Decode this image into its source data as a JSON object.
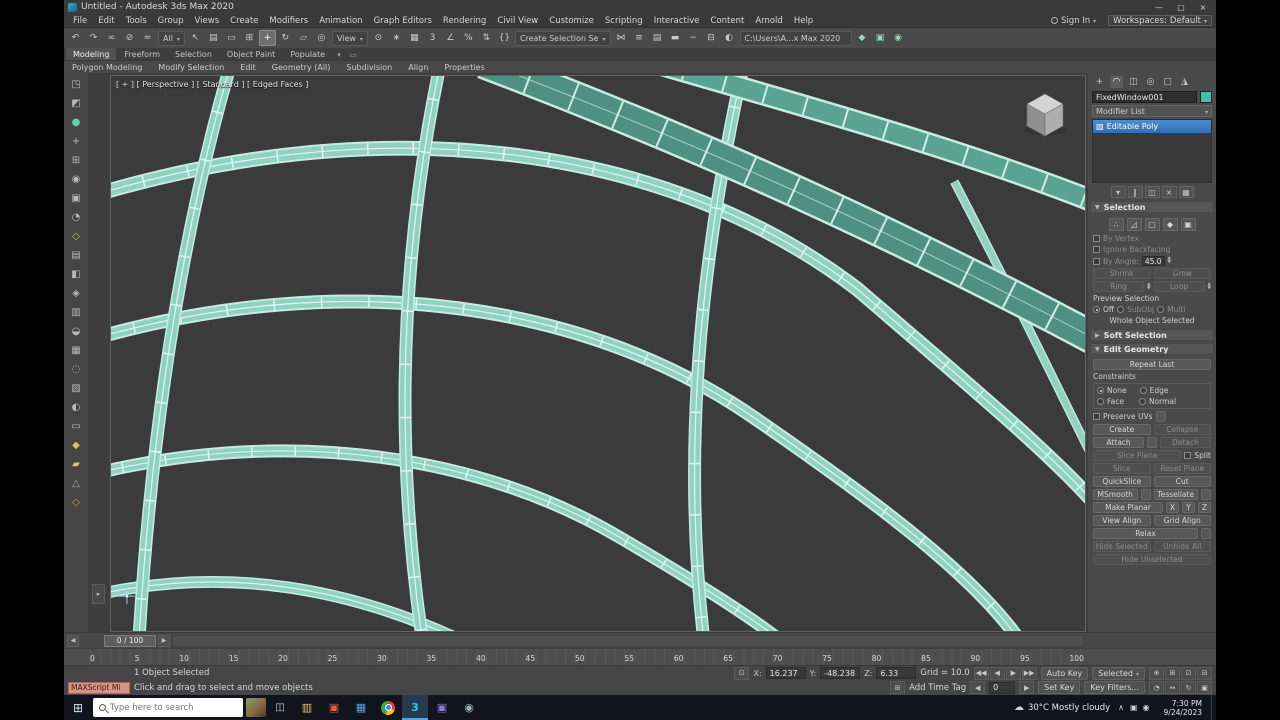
{
  "colors": {
    "frame_teal": "#8fd2c0",
    "frame_teal_dark": "#4e9182",
    "selection_highlight": "#2f6db4",
    "viewport_bg": "#3b3b3b",
    "object_color": "#3fc2a7"
  },
  "titlebar": {
    "title": "Untitled - Autodesk 3ds Max 2020",
    "minimize": "—",
    "maximize": "▢",
    "close": "×"
  },
  "menubar": {
    "items": [
      "File",
      "Edit",
      "Tools",
      "Group",
      "Views",
      "Create",
      "Modifiers",
      "Animation",
      "Graph Editors",
      "Rendering",
      "Civil View",
      "Customize",
      "Scripting",
      "Interactive",
      "Content",
      "Arnold",
      "Help"
    ],
    "sign_in": "Sign In",
    "workspaces_label": "Workspaces:",
    "workspaces_value": "Default"
  },
  "toolbar": {
    "icons_a": [
      {
        "name": "undo-icon",
        "g": "↶"
      },
      {
        "name": "redo-icon",
        "g": "↷"
      },
      {
        "name": "select-and-link-icon",
        "g": "∞"
      },
      {
        "name": "unlink-selection-icon",
        "g": "⊘"
      },
      {
        "name": "bind-to-space-warp-icon",
        "g": "≈"
      }
    ],
    "selection_filter": "All",
    "icons_b": [
      {
        "name": "select-object-icon",
        "g": "↖"
      },
      {
        "name": "select-by-name-icon",
        "g": "▤"
      },
      {
        "name": "rectangular-selection-region-icon",
        "g": "▭"
      },
      {
        "name": "window-crossing-icon",
        "g": "⊞"
      },
      {
        "name": "select-and-move-icon",
        "g": "+",
        "active": true
      },
      {
        "name": "select-and-rotate-icon",
        "g": "↻"
      },
      {
        "name": "select-and-scale-icon",
        "g": "▱"
      },
      {
        "name": "select-and-place-icon",
        "g": "◎"
      }
    ],
    "reference_coordinate": "View",
    "icons_c": [
      {
        "name": "use-pivot-point-center-icon",
        "g": "⊙"
      },
      {
        "name": "select-and-manipulate-icon",
        "g": "∗"
      },
      {
        "name": "keyboard-shortcut-override-icon",
        "g": "▦"
      },
      {
        "name": "snaps-toggle-icon",
        "g": "3"
      },
      {
        "name": "angle-snap-icon",
        "g": "∠"
      },
      {
        "name": "percent-snap-icon",
        "g": "%"
      },
      {
        "name": "spinner-snap-icon",
        "g": "⇅"
      },
      {
        "name": "named-selection-sets-icon",
        "g": "{}"
      }
    ],
    "selection_set": "Create Selection Se",
    "icons_d": [
      {
        "name": "mirror-icon",
        "g": "⋈"
      },
      {
        "name": "align-icon",
        "g": "≡"
      },
      {
        "name": "layer-explorer-icon",
        "g": "▤"
      },
      {
        "name": "ribbon-toggle-icon",
        "g": "▬"
      },
      {
        "name": "curve-editor-icon",
        "g": "~"
      },
      {
        "name": "schematic-view-icon",
        "g": "⊟"
      },
      {
        "name": "material-editor-icon",
        "g": "◐"
      }
    ],
    "project_path": "C:\\Users\\A...x Max 2020",
    "icons_e": [
      {
        "name": "render-setup-icon",
        "g": "◆",
        "fg": "#9fd6b0"
      },
      {
        "name": "rendered-frame-window-icon",
        "g": "▣",
        "fg": "#9fd6b0"
      },
      {
        "name": "render-production-icon",
        "g": "◉",
        "fg": "#9fd6b0"
      }
    ]
  },
  "ribbon": {
    "tabs": [
      {
        "name": "ribbon-tab-modeling",
        "label": "Modeling",
        "active": true
      },
      {
        "name": "ribbon-tab-freeform",
        "label": "Freeform"
      },
      {
        "name": "ribbon-tab-selection",
        "label": "Selection"
      },
      {
        "name": "ribbon-tab-object-paint",
        "label": "Object Paint"
      },
      {
        "name": "ribbon-tab-populate",
        "label": "Populate"
      }
    ],
    "panels": [
      {
        "name": "ribbon-panel-polygon-modeling",
        "label": "Polygon Modeling"
      },
      {
        "name": "ribbon-panel-modify-selection",
        "label": "Modify Selection"
      },
      {
        "name": "ribbon-panel-edit",
        "label": "Edit"
      },
      {
        "name": "ribbon-panel-geometry-all",
        "label": "Geometry (All)"
      },
      {
        "name": "ribbon-panel-subdivision",
        "label": "Subdivision"
      },
      {
        "name": "ribbon-panel-align",
        "label": "Align"
      },
      {
        "name": "ribbon-panel-properties",
        "label": "Properties"
      }
    ]
  },
  "left_toolbar": {
    "icons": [
      {
        "name": "left-tool-icon-1",
        "g": "◳"
      },
      {
        "name": "left-tool-icon-2",
        "g": "◩"
      },
      {
        "name": "left-tool-icon-3",
        "g": "●",
        "fg": "#5fd3b5"
      },
      {
        "name": "left-tool-icon-4",
        "g": "+"
      },
      {
        "name": "left-tool-icon-5",
        "g": "⊞"
      },
      {
        "name": "left-tool-icon-6",
        "g": "◉"
      },
      {
        "name": "left-tool-icon-7",
        "g": "▣"
      },
      {
        "name": "left-tool-icon-8",
        "g": "◔"
      },
      {
        "name": "left-tool-icon-9",
        "g": "◇",
        "fg": "#9fd470"
      },
      {
        "name": "left-tool-icon-10",
        "g": "▤"
      },
      {
        "name": "left-tool-icon-11",
        "g": "◧"
      },
      {
        "name": "left-tool-icon-12",
        "g": "◈"
      },
      {
        "name": "left-tool-icon-13",
        "g": "▥"
      },
      {
        "name": "left-tool-icon-14",
        "g": "◒"
      },
      {
        "name": "left-tool-icon-15",
        "g": "▦"
      },
      {
        "name": "left-tool-icon-16",
        "g": "◌"
      },
      {
        "name": "left-tool-icon-17",
        "g": "▧"
      },
      {
        "name": "left-tool-icon-18",
        "g": "◐"
      },
      {
        "name": "left-tool-icon-19",
        "g": "▭"
      },
      {
        "name": "left-tool-icon-20",
        "g": "◆",
        "fg": "#d9c26a"
      },
      {
        "name": "left-tool-icon-21",
        "g": "▰",
        "fg": "#d9c26a"
      },
      {
        "name": "left-tool-icon-22",
        "g": "△"
      },
      {
        "name": "left-tool-icon-23",
        "g": "◇",
        "fg": "#c9a05a"
      }
    ]
  },
  "viewport": {
    "label": "[ + ] [ Perspective ] [ Standard ] [ Edged Faces ]"
  },
  "command_panel": {
    "tabs": [
      {
        "name": "create-tab-icon",
        "g": "+"
      },
      {
        "name": "modify-tab-icon",
        "g": "◠",
        "active": true
      },
      {
        "name": "hierarchy-tab-icon",
        "g": "◫"
      },
      {
        "name": "motion-tab-icon",
        "g": "◎"
      },
      {
        "name": "display-tab-icon",
        "g": "▢"
      },
      {
        "name": "utilities-tab-icon",
        "g": "◮"
      }
    ],
    "object_name": "FixedWindow001",
    "modifier_list_label": "Modifier List",
    "stack_item": "Editable Poly",
    "stack_buttons": [
      {
        "name": "pin-stack-icon",
        "g": "▾"
      },
      {
        "name": "show-end-result-icon",
        "g": "∥"
      },
      {
        "name": "make-unique-icon",
        "g": "◫"
      },
      {
        "name": "remove-modifier-icon",
        "g": "×"
      },
      {
        "name": "configure-modifier-sets-icon",
        "g": "▦"
      }
    ],
    "selection": {
      "header": "Selection",
      "subobject_icons": [
        {
          "name": "vertex-subobject-icon",
          "g": "∴"
        },
        {
          "name": "edge-subobject-icon",
          "g": "◿"
        },
        {
          "name": "border-subobject-icon",
          "g": "▢"
        },
        {
          "name": "polygon-subobject-icon",
          "g": "◆"
        },
        {
          "name": "element-subobject-icon",
          "g": "▣"
        }
      ],
      "by_vertex": "By Vertex",
      "ignore_backfacing": "Ignore Backfacing",
      "by_angle": "By Angle:",
      "angle_value": "45.0",
      "shrink": "Shrink",
      "grow": "Grow",
      "ring": "Ring",
      "loop": "Loop",
      "preview_label": "Preview Selection",
      "preview_off": "Off",
      "preview_subobj": "SubObj",
      "preview_multi": "Multi",
      "status_text": "Whole Object Selected"
    },
    "soft_selection_header": "Soft Selection",
    "edit_geometry": {
      "header": "Edit Geometry",
      "repeat_last": "Repeat Last",
      "constraints": "Constraints",
      "none": "None",
      "edge": "Edge",
      "face": "Face",
      "normal": "Normal",
      "preserve_uvs": "Preserve UVs",
      "create": "Create",
      "collapse": "Collapse",
      "attach": "Attach",
      "detach": "Detach",
      "slice_plane": "Slice Plane",
      "split": "Split",
      "slice": "Slice",
      "reset_plane": "Reset Plane",
      "quickslice": "QuickSlice",
      "cut": "Cut",
      "msmooth": "MSmooth",
      "tessellate": "Tessellate",
      "make_planar": "Make Planar",
      "x": "X",
      "y": "Y",
      "z": "Z",
      "view_align": "View Align",
      "grid_align": "Grid Align",
      "relax": "Relax",
      "hide_selected": "Hide Selected",
      "unhide_all": "Unhide All",
      "hide_unselected": "Hide Unselected"
    }
  },
  "timeline": {
    "slider": "0 / 100",
    "ticks": [
      "0",
      "5",
      "10",
      "15",
      "20",
      "25",
      "30",
      "35",
      "40",
      "45",
      "50",
      "55",
      "60",
      "65",
      "70",
      "75",
      "80",
      "85",
      "90",
      "95",
      "100"
    ]
  },
  "status": {
    "maxscript": "MAXScript Mi",
    "selection_line": "1 Object Selected",
    "prompt_line": "Click and drag to select and move objects",
    "x_label": "X:",
    "x_value": "16.237",
    "y_label": "Y:",
    "y_value": "-48.238",
    "z_label": "Z:",
    "z_value": "6.33",
    "grid_label": "Grid = 10.0",
    "add_time_tag": "Add Time Tag",
    "frame_value": "0",
    "auto_key": "Auto Key",
    "selected_set": "Selected",
    "set_key": "Set Key",
    "key_filters": "Key Filters...",
    "playback_row1": [
      {
        "name": "go-to-start-icon",
        "g": "◀◀"
      },
      {
        "name": "previous-frame-icon",
        "g": "◀"
      },
      {
        "name": "play-animation-icon",
        "g": "▶"
      },
      {
        "name": "go-to-end-icon",
        "g": "▶▶"
      }
    ],
    "nav_row1": [
      {
        "name": "zoom-icon",
        "g": "⊕"
      },
      {
        "name": "zoom-all-icon",
        "g": "⊞"
      },
      {
        "name": "zoom-extents-icon",
        "g": "⊡"
      },
      {
        "name": "zoom-extents-all-icon",
        "g": "⊟"
      }
    ],
    "nav_row2": [
      {
        "name": "field-of-view-icon",
        "g": "◔"
      },
      {
        "name": "pan-view-icon",
        "g": "↔"
      },
      {
        "name": "orbit-icon",
        "g": "↻"
      },
      {
        "name": "maximize-viewport-toggle-icon",
        "g": "▣"
      }
    ]
  },
  "taskbar": {
    "search_placeholder": "Type here to search",
    "apps": [
      {
        "name": "file-explorer-icon",
        "g": "▥",
        "fg": "#ecc565"
      },
      {
        "name": "office-app-icon",
        "g": "▣",
        "fg": "#e0653a"
      },
      {
        "name": "mail-app-icon",
        "g": "▦",
        "fg": "#58a0e8"
      },
      {
        "name": "chrome-icon",
        "cls": "chrome"
      },
      {
        "name": "3ds-max-taskbar-icon",
        "g": "3",
        "fg": "#35c4e8",
        "active": true
      },
      {
        "name": "creative-app-icon",
        "g": "▣",
        "fg": "#8e7bda"
      },
      {
        "name": "capture-app-icon",
        "g": "◉",
        "fg": "#9db4c0"
      }
    ],
    "tray_icons": [
      {
        "name": "tray-icon-1",
        "g": "▣"
      },
      {
        "name": "tray-icon-2",
        "g": "◉"
      }
    ],
    "weather": "30°C Mostly cloudy",
    "time": "7:30 PM",
    "date": "9/24/2023"
  }
}
